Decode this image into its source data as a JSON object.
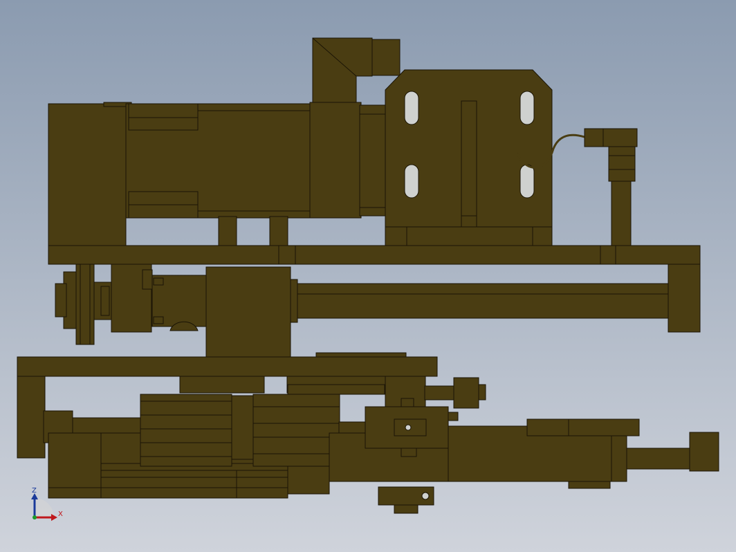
{
  "colors": {
    "background_top": "#8b9bb0",
    "background_bottom": "#cfd3db",
    "part_fill": "#4a3d12",
    "part_edge": "#1a1405",
    "triad_x": "#c0181c",
    "triad_z": "#1a3a9a"
  },
  "triad": {
    "z_label": "Z",
    "x_label": "X"
  }
}
